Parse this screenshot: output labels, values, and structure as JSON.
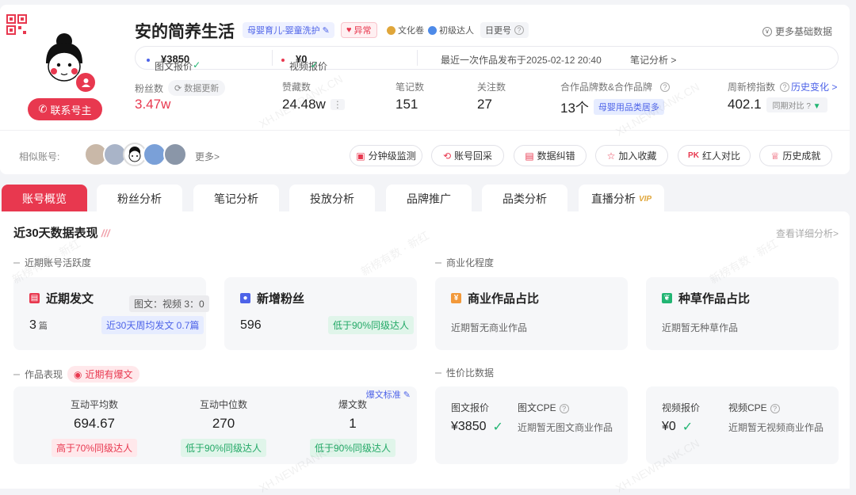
{
  "profile": {
    "name": "安的简养生活",
    "category_tag": "母婴育儿-婴童洗护",
    "abnormal_tag": "异常",
    "badge1": "文化卷",
    "badge2": "初级达人",
    "update_freq": "日更号",
    "more_basic": "更多基础数据",
    "contact_btn": "联系号主"
  },
  "pricebar": {
    "image_label": "图文报价",
    "image_value": "¥3850",
    "video_label": "视频报价",
    "video_value": "¥0",
    "last_post": "最近一次作品发布于2025-02-12 20:40",
    "note_analysis": "笔记分析 >"
  },
  "stats": {
    "fans_label": "粉丝数",
    "data_update": "数据更新",
    "fans_value": "3.47w",
    "likes_label": "赞藏数",
    "likes_value": "24.48w",
    "notes_label": "笔记数",
    "notes_value": "151",
    "follow_label": "关注数",
    "follow_value": "27",
    "brand_label": "合作品牌数&合作品牌",
    "brand_value": "13个",
    "brand_tag": "母婴用品类居多",
    "rank_label": "周新榜指数",
    "rank_link": "历史变化 >",
    "rank_value": "402.1",
    "rank_compare": "同期对比"
  },
  "similar": {
    "label": "相似账号:",
    "more": "更多>"
  },
  "actions": [
    "分钟级监测",
    "账号回采",
    "数据纠错",
    "加入收藏",
    "红人对比",
    "历史成就"
  ],
  "tabs": [
    "账号概览",
    "粉丝分析",
    "笔记分析",
    "投放分析",
    "品牌推广",
    "品类分析",
    "直播分析"
  ],
  "tab_vip": "VIP",
  "overview": {
    "title": "近30天数据表现",
    "view_detail": "查看详细分析>",
    "activity_label": "近期账号活跃度",
    "commercial_label": "商业化程度",
    "perf_label": "作品表现",
    "hot_tag": "近期有爆文",
    "value_label": "性价比数据"
  },
  "cards": {
    "recent_post": {
      "title": "近期发文",
      "ratio": "图文：视频 3：0",
      "value": "3",
      "unit": "篇",
      "weekly": "近30天周均发文 0.7篇"
    },
    "new_fans": {
      "title": "新增粉丝",
      "value": "596",
      "compare": "低于90%同级达人"
    },
    "commercial": {
      "title": "商业作品占比",
      "empty": "近期暂无商业作品"
    },
    "seeding": {
      "title": "种草作品占比",
      "empty": "近期暂无种草作品"
    }
  },
  "performance": {
    "hot_standard": "爆文标准",
    "cols": [
      {
        "label": "互动平均数",
        "value": "694.67",
        "compare": "高于70%同级达人"
      },
      {
        "label": "互动中位数",
        "value": "270",
        "compare": "低于90%同级达人"
      },
      {
        "label": "爆文数",
        "value": "1",
        "compare": "低于90%同级达人"
      }
    ]
  },
  "value_data": {
    "image_price_label": "图文报价",
    "image_price": "¥3850",
    "image_cpe_label": "图文CPE",
    "image_cpe_empty": "近期暂无图文商业作品",
    "video_price_label": "视频报价",
    "video_price": "¥0",
    "video_cpe_label": "视频CPE",
    "video_cpe_empty": "近期暂无视频商业作品"
  },
  "watermark": [
    "XH.NEWRANK.CN",
    "新榜有数 · 新红"
  ],
  "colors": {
    "accent": "#e8384f",
    "blue": "#4d63e8",
    "green": "#22b573"
  }
}
